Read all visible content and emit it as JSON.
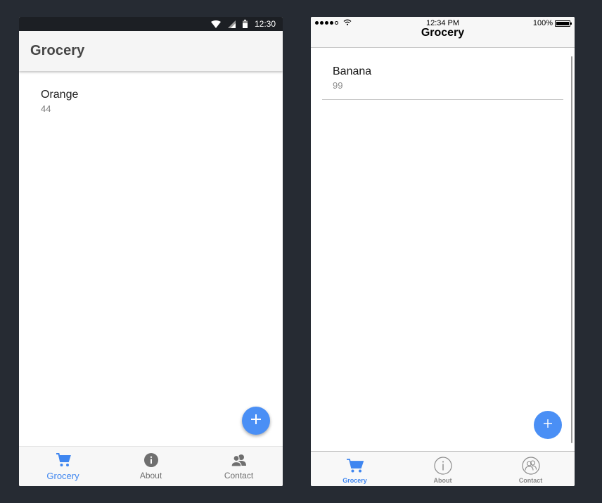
{
  "android": {
    "status_bar": {
      "time": "12:30"
    },
    "header": {
      "title": "Grocery"
    },
    "list": [
      {
        "name": "Orange",
        "quantity": "44"
      }
    ],
    "fab": {
      "icon": "plus-icon"
    },
    "tabs": [
      {
        "label": "Grocery",
        "icon": "cart-icon",
        "active": true
      },
      {
        "label": "About",
        "icon": "info-icon",
        "active": false
      },
      {
        "label": "Contact",
        "icon": "contacts-icon",
        "active": false
      }
    ]
  },
  "ios": {
    "status_bar": {
      "time": "12:34 PM",
      "battery": "100%"
    },
    "header": {
      "title": "Grocery"
    },
    "list": [
      {
        "name": "Banana",
        "quantity": "99"
      }
    ],
    "fab": {
      "icon": "plus-icon"
    },
    "tabs": [
      {
        "label": "Grocery",
        "icon": "cart-icon",
        "active": true
      },
      {
        "label": "About",
        "icon": "info-icon",
        "active": false
      },
      {
        "label": "Contact",
        "icon": "contacts-icon",
        "active": false
      }
    ]
  },
  "colors": {
    "background": "#262b33",
    "accent": "#4a8ff5",
    "active_tab": "#3f86f0"
  }
}
